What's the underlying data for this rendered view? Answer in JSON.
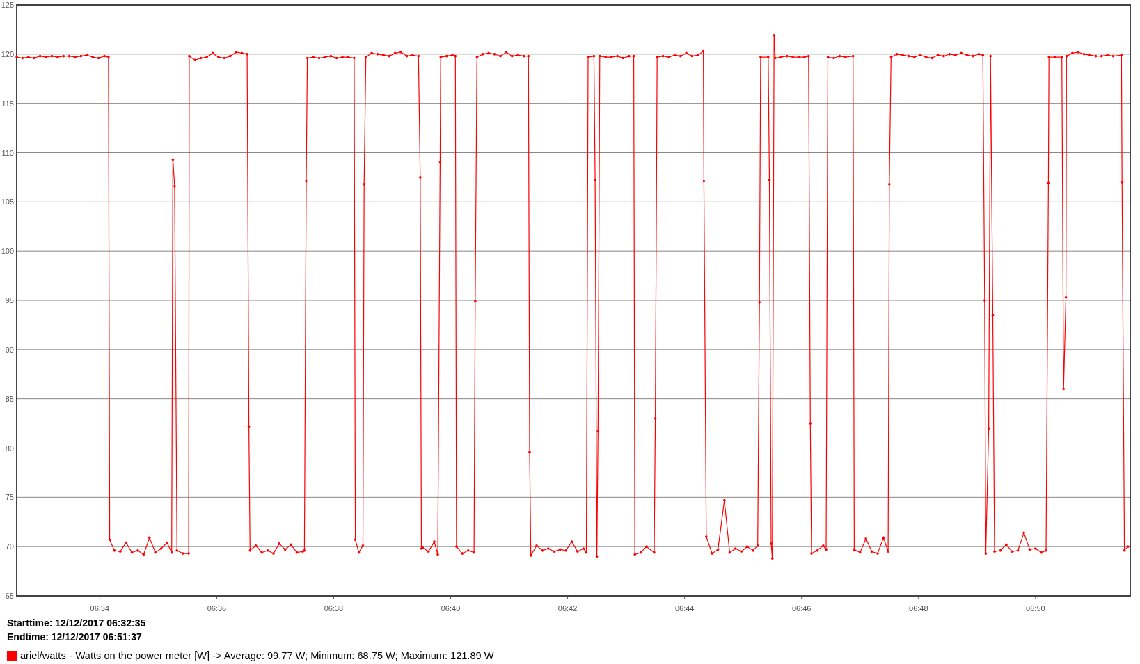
{
  "chart": {
    "chart_data": {
      "type": "line",
      "grid": true,
      "xlim": [
        392.58,
        411.62
      ],
      "ylim": [
        65,
        125
      ],
      "yticks": [
        65,
        70,
        75,
        80,
        85,
        90,
        95,
        100,
        105,
        110,
        115,
        120,
        125
      ],
      "xticks": [
        {
          "value": 394,
          "label": "06:34"
        },
        {
          "value": 396,
          "label": "06:36"
        },
        {
          "value": 398,
          "label": "06:38"
        },
        {
          "value": 400,
          "label": "06:40"
        },
        {
          "value": 402,
          "label": "06:42"
        },
        {
          "value": 404,
          "label": "06:44"
        },
        {
          "value": 406,
          "label": "06:46"
        },
        {
          "value": 408,
          "label": "06:48"
        },
        {
          "value": 410,
          "label": "06:50"
        }
      ],
      "x": [
        392.58,
        392.68,
        392.78,
        392.88,
        392.98,
        393.08,
        393.18,
        393.28,
        393.38,
        393.48,
        393.58,
        393.68,
        393.78,
        393.88,
        393.98,
        394.08,
        394.15,
        394.17,
        394.25,
        394.35,
        394.45,
        394.55,
        394.65,
        394.75,
        394.85,
        394.95,
        395.05,
        395.15,
        395.23,
        395.25,
        395.28,
        395.32,
        395.42,
        395.52,
        395.53,
        395.63,
        395.73,
        395.83,
        395.93,
        396.03,
        396.13,
        396.23,
        396.33,
        396.43,
        396.52,
        396.55,
        396.57,
        396.67,
        396.77,
        396.87,
        396.97,
        397.07,
        397.17,
        397.27,
        397.37,
        397.47,
        397.5,
        397.53,
        397.55,
        397.65,
        397.75,
        397.85,
        397.95,
        398.05,
        398.15,
        398.25,
        398.35,
        398.37,
        398.43,
        398.5,
        398.52,
        398.55,
        398.65,
        398.75,
        398.85,
        398.95,
        399.05,
        399.15,
        399.25,
        399.35,
        399.45,
        399.48,
        399.5,
        399.52,
        399.62,
        399.72,
        399.78,
        399.82,
        399.83,
        399.93,
        400.03,
        400.08,
        400.1,
        400.2,
        400.3,
        400.4,
        400.42,
        400.45,
        400.55,
        400.65,
        400.75,
        400.85,
        400.95,
        401.05,
        401.15,
        401.25,
        401.33,
        401.35,
        401.37,
        401.47,
        401.57,
        401.67,
        401.77,
        401.87,
        401.97,
        402.07,
        402.17,
        402.27,
        402.32,
        402.35,
        402.45,
        402.47,
        402.5,
        402.52,
        402.55,
        402.65,
        402.75,
        402.85,
        402.95,
        403.05,
        403.13,
        403.15,
        403.25,
        403.35,
        403.48,
        403.5,
        403.53,
        403.63,
        403.73,
        403.83,
        403.93,
        404.03,
        404.13,
        404.23,
        404.32,
        404.33,
        404.37,
        404.47,
        404.57,
        404.68,
        404.77,
        404.87,
        404.97,
        405.07,
        405.17,
        405.25,
        405.28,
        405.3,
        405.43,
        405.45,
        405.48,
        405.5,
        405.53,
        405.55,
        405.65,
        405.75,
        405.85,
        405.95,
        406.05,
        406.12,
        406.15,
        406.17,
        406.27,
        406.37,
        406.42,
        406.45,
        406.55,
        406.65,
        406.75,
        406.88,
        406.9,
        407.0,
        407.1,
        407.2,
        407.3,
        407.4,
        407.48,
        407.5,
        407.53,
        407.63,
        407.73,
        407.83,
        407.93,
        408.03,
        408.13,
        408.23,
        408.33,
        408.43,
        408.53,
        408.63,
        408.73,
        408.83,
        408.93,
        409.03,
        409.1,
        409.13,
        409.15,
        409.2,
        409.23,
        409.27,
        409.3,
        409.4,
        409.5,
        409.6,
        409.7,
        409.8,
        409.9,
        410.0,
        410.1,
        410.18,
        410.22,
        410.23,
        410.33,
        410.45,
        410.48,
        410.52,
        410.53,
        410.63,
        410.73,
        410.83,
        410.93,
        411.03,
        411.13,
        411.23,
        411.33,
        411.47,
        411.48,
        411.52,
        411.58
      ],
      "series": [
        {
          "name": "ariel/watts",
          "color": "#ff0000",
          "values": [
            119.7,
            119.6,
            119.7,
            119.6,
            119.8,
            119.7,
            119.8,
            119.7,
            119.8,
            119.8,
            119.7,
            119.8,
            119.9,
            119.7,
            119.6,
            119.8,
            119.7,
            70.7,
            69.6,
            69.5,
            70.4,
            69.4,
            69.6,
            69.2,
            70.9,
            69.4,
            69.8,
            70.4,
            69.4,
            109.3,
            106.6,
            69.6,
            69.3,
            69.3,
            119.8,
            119.4,
            119.6,
            119.7,
            120.1,
            119.7,
            119.6,
            119.8,
            120.2,
            120.1,
            120.0,
            82.2,
            69.6,
            70.1,
            69.4,
            69.6,
            69.3,
            70.3,
            69.7,
            70.2,
            69.4,
            69.5,
            69.6,
            107.1,
            119.6,
            119.7,
            119.6,
            119.7,
            119.8,
            119.6,
            119.7,
            119.7,
            119.6,
            70.7,
            69.4,
            70.1,
            106.8,
            119.7,
            120.1,
            120.0,
            119.9,
            119.8,
            120.1,
            120.2,
            119.8,
            119.9,
            119.8,
            107.5,
            69.8,
            69.9,
            69.5,
            70.5,
            69.2,
            109.0,
            119.7,
            119.8,
            119.9,
            119.8,
            70.0,
            69.3,
            69.6,
            69.4,
            94.9,
            119.7,
            120.0,
            120.1,
            120.0,
            119.8,
            120.2,
            119.8,
            119.9,
            119.8,
            119.8,
            79.6,
            69.1,
            70.1,
            69.6,
            69.8,
            69.5,
            69.7,
            69.6,
            70.5,
            69.5,
            69.8,
            69.4,
            119.7,
            119.8,
            107.2,
            69.0,
            81.7,
            119.8,
            119.7,
            119.7,
            119.8,
            119.6,
            119.8,
            119.8,
            69.2,
            69.4,
            70.0,
            69.4,
            83.0,
            119.7,
            119.8,
            119.7,
            119.9,
            119.8,
            120.1,
            119.8,
            119.9,
            120.3,
            107.1,
            71.0,
            69.3,
            69.7,
            74.7,
            69.4,
            69.8,
            69.5,
            70.0,
            69.6,
            70.1,
            94.8,
            119.7,
            119.7,
            107.2,
            70.3,
            68.8,
            121.9,
            119.6,
            119.7,
            119.8,
            119.7,
            119.7,
            119.7,
            119.8,
            82.5,
            69.3,
            69.6,
            70.1,
            69.7,
            119.7,
            119.6,
            119.8,
            119.7,
            119.8,
            69.7,
            69.4,
            70.8,
            69.5,
            69.3,
            70.9,
            69.5,
            106.8,
            119.7,
            120.0,
            119.9,
            119.8,
            119.7,
            119.9,
            119.7,
            119.6,
            119.9,
            119.8,
            120.0,
            119.9,
            120.1,
            119.9,
            119.8,
            120.0,
            119.9,
            95.0,
            69.3,
            82.0,
            119.8,
            93.5,
            69.5,
            69.6,
            70.2,
            69.5,
            69.6,
            71.4,
            69.7,
            69.8,
            69.4,
            69.6,
            106.9,
            119.7,
            119.7,
            119.7,
            86.0,
            95.3,
            119.8,
            120.1,
            120.2,
            120.0,
            119.9,
            119.8,
            119.8,
            119.9,
            119.8,
            119.9,
            107.0,
            69.6,
            70.0
          ]
        }
      ]
    }
  },
  "starttime": "Starttime: 12/12/2017 06:32:35",
  "endtime": "Endtime: 12/12/2017 06:51:37",
  "legend": {
    "label": "- Watts on the power meter [W] -> Average: 99.77 W; Minimum: 68.75 W; Maximum: 121.89 W"
  }
}
